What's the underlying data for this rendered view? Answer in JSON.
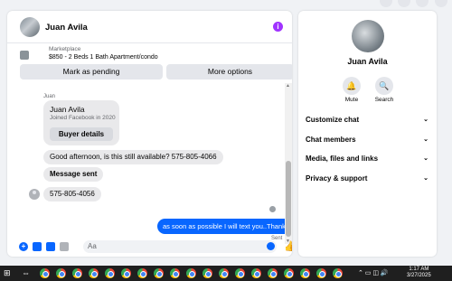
{
  "chat": {
    "name": "Juan Avila",
    "listing_kind": "Marketplace",
    "listing_title": "$850 - 2 Beds 1 Bath Apartment/condo",
    "btn_pending": "Mark as pending",
    "btn_options": "More options",
    "card_sender": "Juan",
    "card_name": "Juan Avila",
    "card_joined": "Joined Facebook in 2020",
    "card_button": "Buyer details",
    "msg1": "Good afternoon, is this still available? 575-805-4066",
    "msg2": "Message sent",
    "msg3": "575-805-4056",
    "msg_out": "as soon as possible I will text you..Thanks",
    "sent_status": "Sent",
    "input_placeholder": "Aa"
  },
  "panel": {
    "name": "Juan Avila",
    "mute": "Mute",
    "search": "Search",
    "rows": [
      "Customize chat",
      "Chat members",
      "Media, files and links",
      "Privacy & support"
    ]
  },
  "taskbar": {
    "time": "1:17 AM",
    "date": "3/27/2025"
  },
  "colors": {
    "accent": "#0866ff",
    "info": "#a033ff"
  }
}
